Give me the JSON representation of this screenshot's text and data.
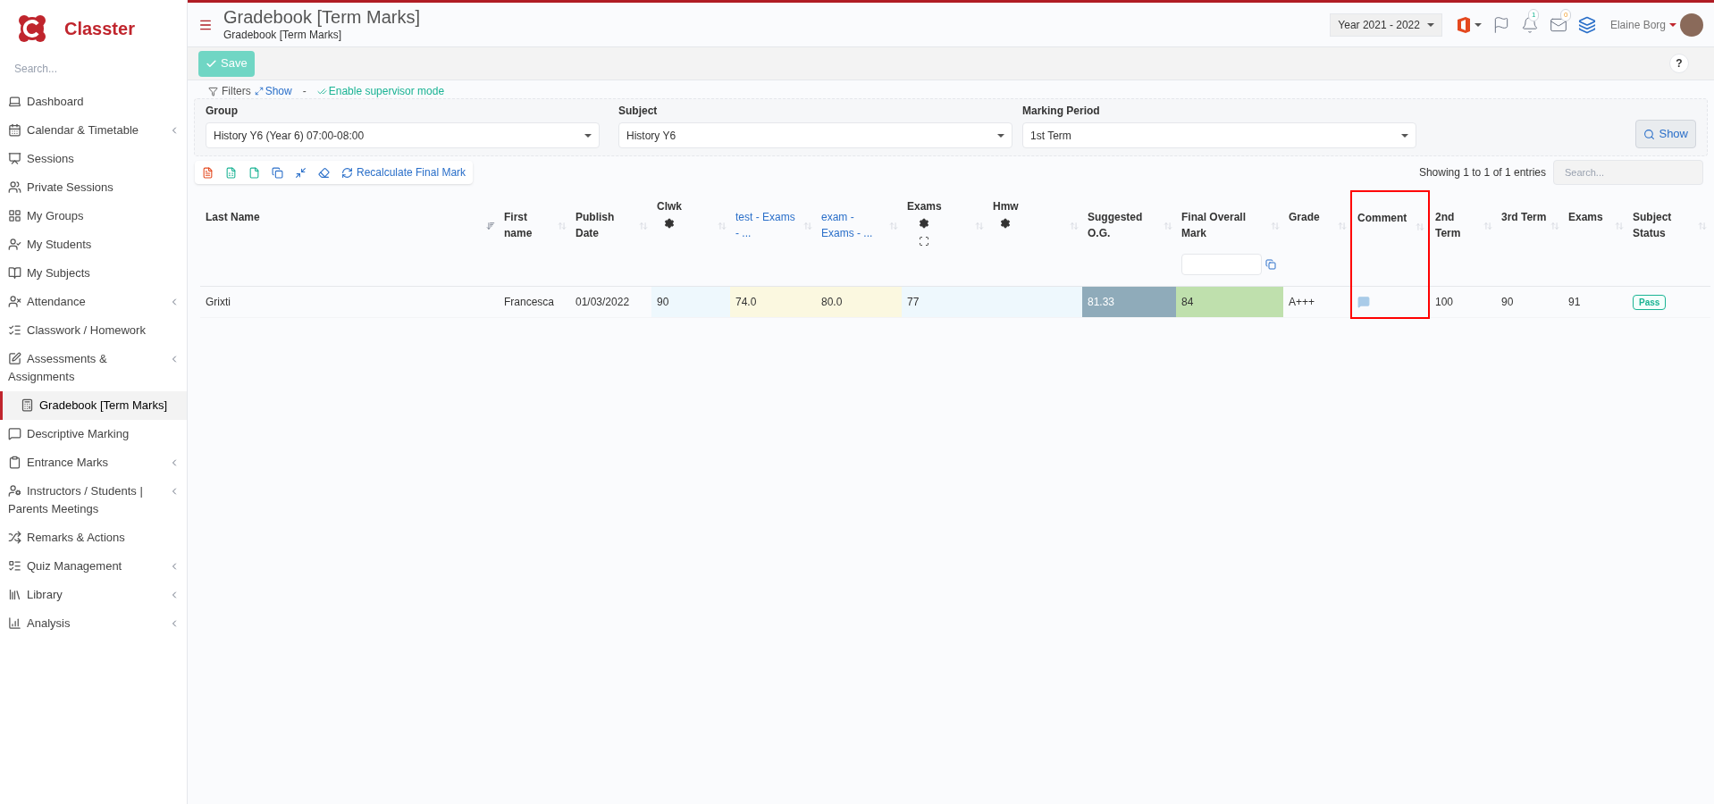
{
  "brand": "Classter",
  "sidebar": {
    "search_placeholder": "Search...",
    "items": [
      {
        "label": "Dashboard",
        "selected": false,
        "has_submenu": false
      },
      {
        "label": "Calendar & Timetable",
        "selected": false,
        "has_submenu": true
      },
      {
        "label": "Sessions",
        "selected": false,
        "has_submenu": false
      },
      {
        "label": "Private Sessions",
        "selected": false,
        "has_submenu": false
      },
      {
        "label": "My Groups",
        "selected": false,
        "has_submenu": false
      },
      {
        "label": "My Students",
        "selected": false,
        "has_submenu": false
      },
      {
        "label": "My Subjects",
        "selected": false,
        "has_submenu": false
      },
      {
        "label": "Attendance",
        "selected": false,
        "has_submenu": true
      },
      {
        "label": "Classwork / Homework",
        "selected": false,
        "has_submenu": false
      },
      {
        "label": "Assessments & Assignments",
        "selected": false,
        "has_submenu": true
      },
      {
        "label": "Gradebook [Term Marks]",
        "selected": true,
        "has_submenu": false
      },
      {
        "label": "Descriptive Marking",
        "selected": false,
        "has_submenu": false
      },
      {
        "label": "Entrance Marks",
        "selected": false,
        "has_submenu": true
      },
      {
        "label": "Instructors / Students | Parents Meetings",
        "selected": false,
        "has_submenu": true
      },
      {
        "label": "Remarks & Actions",
        "selected": false,
        "has_submenu": false
      },
      {
        "label": "Quiz Management",
        "selected": false,
        "has_submenu": true
      },
      {
        "label": "Library",
        "selected": false,
        "has_submenu": true
      },
      {
        "label": "Analysis",
        "selected": false,
        "has_submenu": true
      }
    ]
  },
  "header": {
    "title": "Gradebook [Term Marks]",
    "subtitle": "Gradebook [Term Marks]",
    "year": "Year 2021 - 2022",
    "notifications": "1",
    "messages": "0",
    "user": "Elaine Borg"
  },
  "save_button": "Save",
  "help": "?",
  "filters": {
    "legend": "Filters",
    "show_link": "Show",
    "separator": "-",
    "supervisor": "Enable supervisor mode",
    "show_button": "Show",
    "fields": [
      {
        "label": "Group",
        "value": "History Y6 (Year 6) 07:00-08:00"
      },
      {
        "label": "Subject",
        "value": "History Y6"
      },
      {
        "label": "Marking Period",
        "value": "1st Term"
      }
    ]
  },
  "toolbar": {
    "recalculate": "Recalculate Final Mark"
  },
  "table": {
    "info": "Showing 1 to 1 of 1 entries",
    "search_placeholder": "Search...",
    "columns": [
      {
        "label": "Last Name",
        "kind": "plain",
        "link": false,
        "sorted": true,
        "highlighted": false
      },
      {
        "label": "First name",
        "kind": "plain",
        "link": false,
        "sorted": false,
        "highlighted": false
      },
      {
        "label": "Publish Date",
        "kind": "plain",
        "link": false,
        "sorted": false,
        "highlighted": false
      },
      {
        "label": "Clwk",
        "kind": "settings",
        "link": false,
        "sorted": false,
        "highlighted": false
      },
      {
        "label": "test - Exams - ...",
        "kind": "plain",
        "link": true,
        "sorted": false,
        "highlighted": false
      },
      {
        "label": "exam - Exams - ...",
        "kind": "plain",
        "link": true,
        "sorted": false,
        "highlighted": false
      },
      {
        "label": "Exams",
        "kind": "settings_expand",
        "link": false,
        "sorted": false,
        "highlighted": false
      },
      {
        "label": "Hmw",
        "kind": "settings",
        "link": false,
        "sorted": false,
        "highlighted": false
      },
      {
        "label": "Suggested O.G.",
        "kind": "plain",
        "link": false,
        "sorted": false,
        "highlighted": false
      },
      {
        "label": "Final Overall Mark",
        "kind": "input",
        "link": false,
        "sorted": false,
        "highlighted": false
      },
      {
        "label": "Grade",
        "kind": "plain",
        "link": false,
        "sorted": false,
        "highlighted": false
      },
      {
        "label": "Comment",
        "kind": "plain",
        "link": false,
        "sorted": false,
        "highlighted": true
      },
      {
        "label": "2nd Term",
        "kind": "plain",
        "link": false,
        "sorted": false,
        "highlighted": false
      },
      {
        "label": "3rd Term",
        "kind": "plain",
        "link": false,
        "sorted": false,
        "highlighted": false
      },
      {
        "label": "Exams",
        "kind": "plain",
        "link": false,
        "sorted": false,
        "highlighted": false
      },
      {
        "label": "Subject Status",
        "kind": "plain",
        "link": false,
        "sorted": false,
        "highlighted": false
      }
    ],
    "rows": [
      [
        {
          "kind": "plain",
          "text": "Grixti"
        },
        {
          "kind": "plain",
          "text": "Francesca"
        },
        {
          "kind": "plain",
          "text": "01/03/2022"
        },
        {
          "kind": "clwk",
          "text": "90"
        },
        {
          "kind": "item",
          "text": "74.0"
        },
        {
          "kind": "item",
          "text": "80.0"
        },
        {
          "kind": "clwk",
          "text": "77"
        },
        {
          "kind": "clwk"
        },
        {
          "kind": "suggested",
          "text": "81.33"
        },
        {
          "kind": "final",
          "text": "84"
        },
        {
          "kind": "plain",
          "text": "A+++"
        },
        {
          "kind": "comment"
        },
        {
          "kind": "plain",
          "text": "100"
        },
        {
          "kind": "plain",
          "text": "90"
        },
        {
          "kind": "plain",
          "text": "91"
        },
        {
          "kind": "status",
          "text": "Pass"
        }
      ]
    ]
  }
}
